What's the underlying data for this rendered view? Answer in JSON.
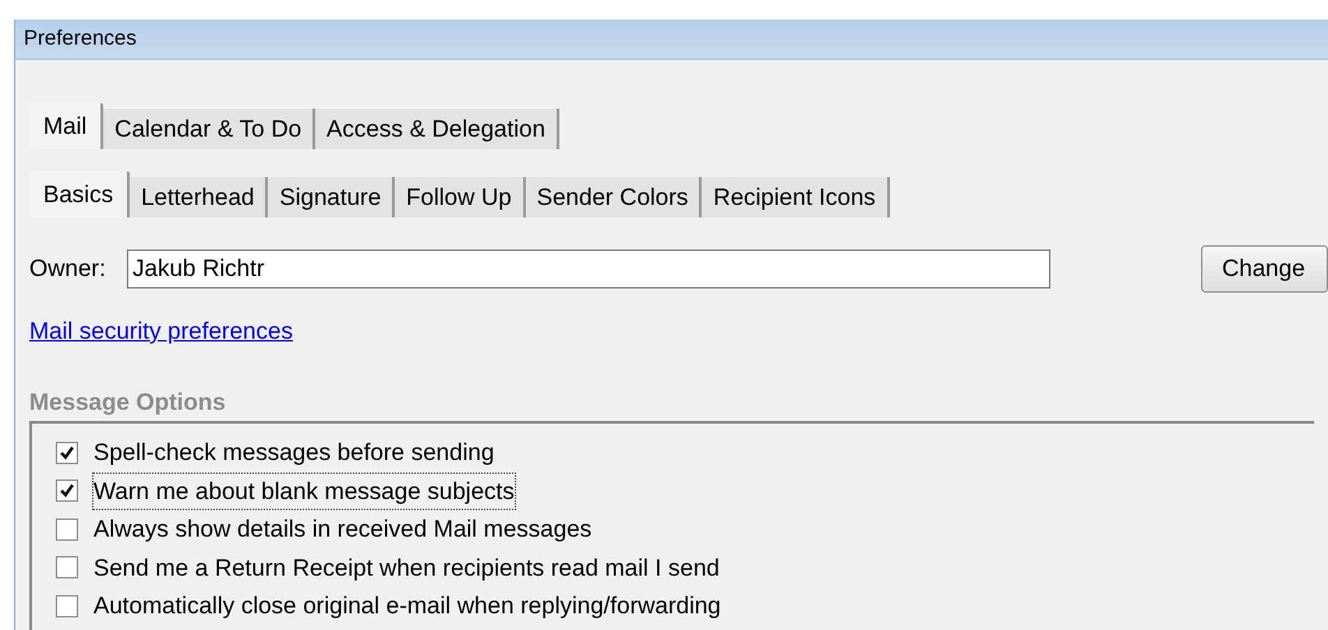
{
  "window": {
    "title": "Preferences"
  },
  "tabs": [
    {
      "label": "Mail",
      "selected": true
    },
    {
      "label": "Calendar & To Do",
      "selected": false
    },
    {
      "label": "Access & Delegation",
      "selected": false
    }
  ],
  "subtabs": [
    {
      "label": "Basics",
      "selected": true
    },
    {
      "label": "Letterhead",
      "selected": false
    },
    {
      "label": "Signature",
      "selected": false
    },
    {
      "label": "Follow Up",
      "selected": false
    },
    {
      "label": "Sender Colors",
      "selected": false
    },
    {
      "label": "Recipient Icons",
      "selected": false
    }
  ],
  "owner": {
    "label": "Owner:",
    "value": "Jakub Richtr"
  },
  "change_button": "Change",
  "security_link": "Mail security preferences",
  "message_options": {
    "title": "Message Options",
    "options": [
      {
        "label": "Spell-check messages before sending",
        "checked": true,
        "focused": false
      },
      {
        "label": "Warn me about blank message subjects",
        "checked": true,
        "focused": true
      },
      {
        "label": "Always show details in received Mail messages",
        "checked": false,
        "focused": false
      },
      {
        "label": "Send me a Return Receipt when recipients read mail I send",
        "checked": false,
        "focused": false
      },
      {
        "label": "Automatically close original e-mail when replying/forwarding",
        "checked": false,
        "focused": false
      }
    ]
  }
}
